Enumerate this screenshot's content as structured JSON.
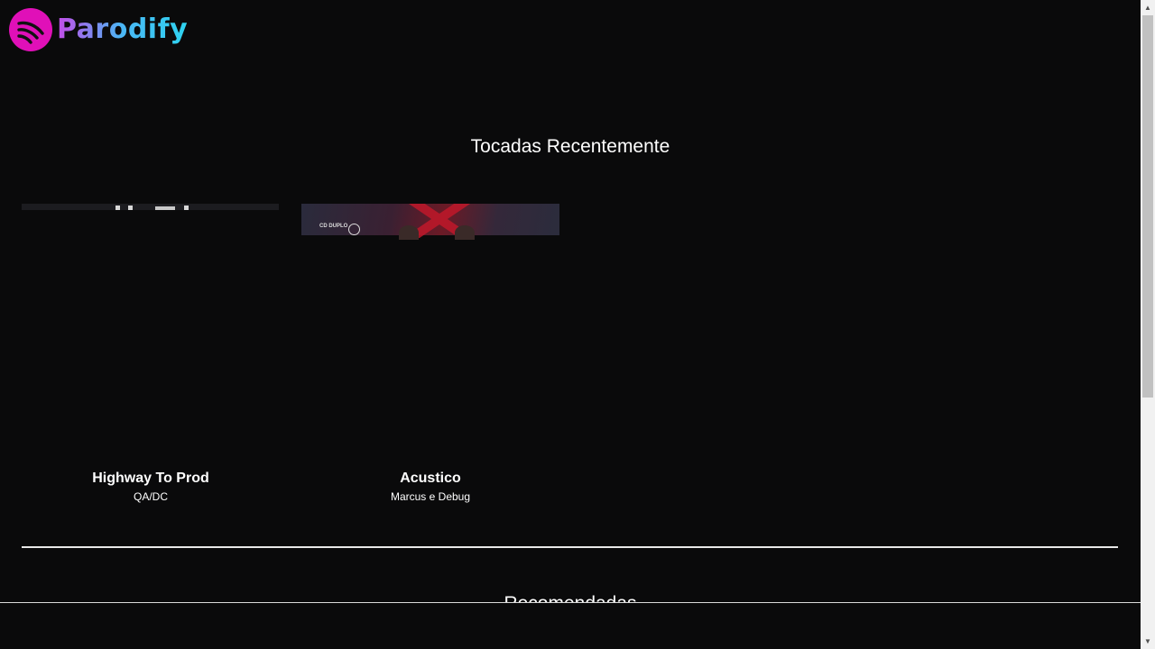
{
  "brand": {
    "name": "Parodify",
    "logo_color": "#e010b8",
    "gradient": [
      "#c44de8",
      "#4ab7f5",
      "#2ed3f0"
    ]
  },
  "sections": {
    "recent": {
      "title": "Tocadas Recentemente",
      "albums": [
        {
          "title": "Highway To Prod",
          "artist": "QA/DC"
        },
        {
          "title": "Acustico",
          "artist": "Marcus e Debug"
        }
      ]
    },
    "recommended": {
      "title": "Recomendadas"
    }
  },
  "cover_badges": {
    "album_2_badge": "CD DUPLO"
  },
  "colors": {
    "background": "#0a0a0b",
    "text": "#ffffff",
    "divider": "#e8e8e8"
  }
}
